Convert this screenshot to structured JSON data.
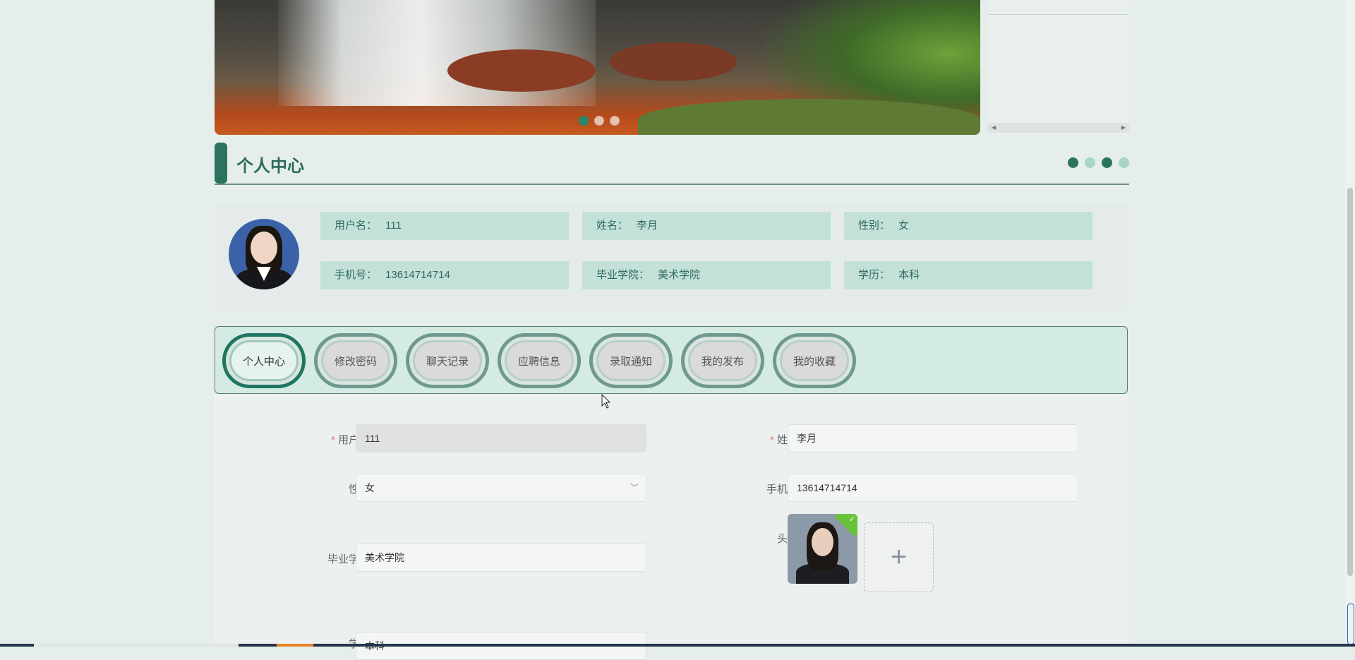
{
  "banner": {
    "dots": [
      true,
      false,
      false
    ]
  },
  "section": {
    "title": "个人中心",
    "dot_colors": [
      "#2a735f",
      "#a9d4c7",
      "#2a735f",
      "#a9d4c7"
    ]
  },
  "profile": {
    "username_label": "用户名：",
    "username": "111",
    "name_label": "姓名：",
    "name": "李月",
    "gender_label": "性别：",
    "gender": "女",
    "phone_label": "手机号：",
    "phone": "13614714714",
    "school_label": "毕业学院：",
    "school": "美术学院",
    "edu_label": "学历：",
    "edu": "本科"
  },
  "tabs": [
    {
      "label": "个人中心",
      "active": true
    },
    {
      "label": "修改密码",
      "active": false
    },
    {
      "label": "聊天记录",
      "active": false
    },
    {
      "label": "应聘信息",
      "active": false
    },
    {
      "label": "录取通知",
      "active": false
    },
    {
      "label": "我的发布",
      "active": false
    },
    {
      "label": "我的收藏",
      "active": false
    }
  ],
  "form": {
    "username_label": "用户名",
    "username_value": "111",
    "name_label": "姓名",
    "name_value": "李月",
    "gender_label": "性别",
    "gender_value": "女",
    "phone_label": "手机号",
    "phone_value": "13614714714",
    "avatar_label": "头像",
    "upload_plus": "+",
    "school_label": "毕业学院",
    "school_value": "美术学院",
    "edu_label": "学历",
    "edu_value": "本科"
  },
  "colors": {
    "accent": "#2a735f",
    "info_bg": "#c4e1d9",
    "required": "#f56c6c"
  }
}
